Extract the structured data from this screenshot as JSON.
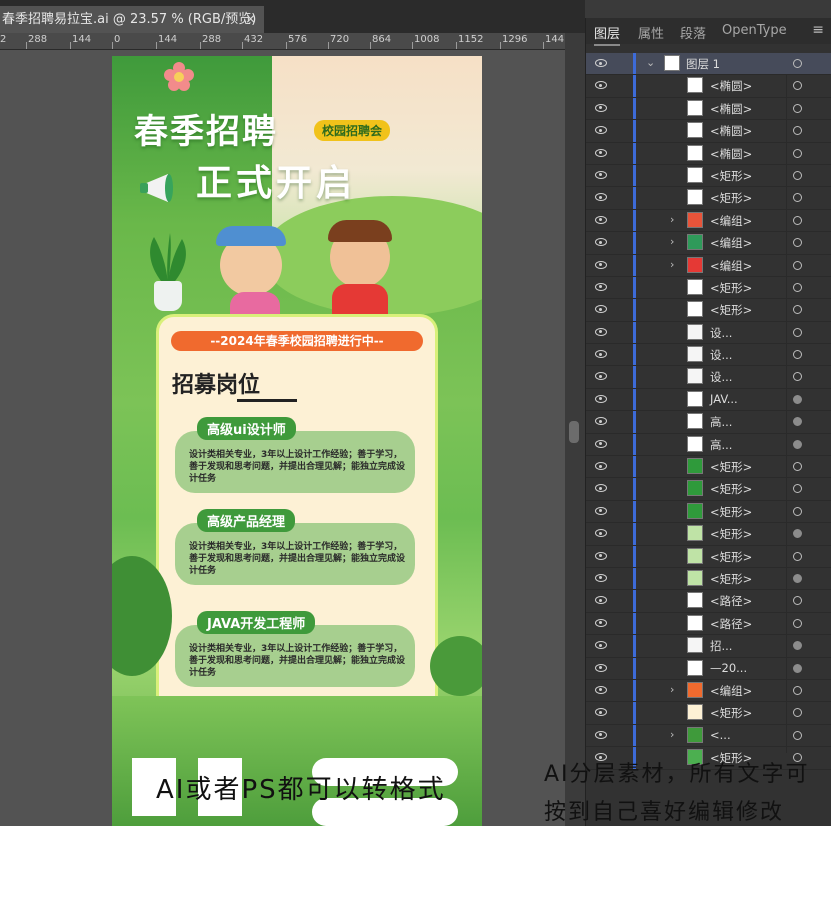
{
  "document": {
    "tab_title": "春季招聘易拉宝.ai @ 23.57 % (RGB/预览)",
    "close_glyph": "×"
  },
  "ruler": {
    "ticks": [
      "2",
      "288",
      "144",
      "0",
      "144",
      "288",
      "432",
      "576",
      "720",
      "864",
      "1008",
      "1152",
      "1296",
      "144"
    ]
  },
  "poster": {
    "title_line1": "春季招聘",
    "badge": "校园招聘会",
    "title_line2": "正式开启",
    "banner": "--2024年春季校园招聘进行中--",
    "section_title": "招募岗位",
    "jobs": [
      {
        "title": "高级ui设计师",
        "desc": "设计类相关专业，3年以上设计工作经验；善于学习，善于发现和思考问题，并提出合理见解；能独立完成设计任务"
      },
      {
        "title": "高级产品经理",
        "desc": "设计类相关专业，3年以上设计工作经验；善于学习，善于发现和思考问题，并提出合理见解；能独立完成设计任务"
      },
      {
        "title": "JAVA开发工程师",
        "desc": "设计类相关专业，3年以上设计工作经验；善于学习，善于发现和思考问题，并提出合理见解；能独立完成设计任务"
      }
    ]
  },
  "panel": {
    "tabs": [
      "图层",
      "属性",
      "段落",
      "OpenType"
    ],
    "menu_glyph": "≡",
    "layers": [
      {
        "name": "图层 1",
        "caret": "⌄",
        "selected": true,
        "circle": "open",
        "thumb": "top"
      },
      {
        "name": "<椭圆>",
        "caret": "",
        "circle": "open",
        "thumb": "white"
      },
      {
        "name": "<椭圆>",
        "caret": "",
        "circle": "open",
        "thumb": "white"
      },
      {
        "name": "<椭圆>",
        "caret": "",
        "circle": "open",
        "thumb": "white"
      },
      {
        "name": "<椭圆>",
        "caret": "",
        "circle": "open",
        "thumb": "white"
      },
      {
        "name": "<矩形>",
        "caret": "",
        "circle": "open",
        "thumb": "white"
      },
      {
        "name": "<矩形>",
        "caret": "",
        "circle": "open",
        "thumb": "white"
      },
      {
        "name": "<编组>",
        "caret": "›",
        "circle": "open",
        "thumb": "pin"
      },
      {
        "name": "<编组>",
        "caret": "›",
        "circle": "open",
        "thumb": "globe"
      },
      {
        "name": "<编组>",
        "caret": "›",
        "circle": "open",
        "thumb": "phone"
      },
      {
        "name": "<矩形>",
        "caret": "",
        "circle": "open",
        "thumb": "white"
      },
      {
        "name": "<矩形>",
        "caret": "",
        "circle": "open",
        "thumb": "white"
      },
      {
        "name": "设...",
        "caret": "",
        "circle": "open",
        "thumb": "text"
      },
      {
        "name": "设...",
        "caret": "",
        "circle": "open",
        "thumb": "text"
      },
      {
        "name": "设...",
        "caret": "",
        "circle": "open",
        "thumb": "text"
      },
      {
        "name": "JAV...",
        "caret": "",
        "circle": "filled",
        "thumb": "line"
      },
      {
        "name": "高...",
        "caret": "",
        "circle": "filled",
        "thumb": "line"
      },
      {
        "name": "高...",
        "caret": "",
        "circle": "filled",
        "thumb": "line"
      },
      {
        "name": "<矩形>",
        "caret": "",
        "circle": "open",
        "thumb": "green"
      },
      {
        "name": "<矩形>",
        "caret": "",
        "circle": "open",
        "thumb": "green"
      },
      {
        "name": "<矩形>",
        "caret": "",
        "circle": "open",
        "thumb": "green"
      },
      {
        "name": "<矩形>",
        "caret": "",
        "circle": "filled",
        "thumb": "lightgreen"
      },
      {
        "name": "<矩形>",
        "caret": "",
        "circle": "open",
        "thumb": "lightgreen"
      },
      {
        "name": "<矩形>",
        "caret": "",
        "circle": "filled",
        "thumb": "lightgreen"
      },
      {
        "name": "<路径>",
        "caret": "",
        "circle": "open",
        "thumb": "line"
      },
      {
        "name": "<路径>",
        "caret": "",
        "circle": "open",
        "thumb": "line"
      },
      {
        "name": "招...",
        "caret": "",
        "circle": "filled",
        "thumb": "text"
      },
      {
        "name": "—20...",
        "caret": "",
        "circle": "filled",
        "thumb": "white"
      },
      {
        "name": "<编组>",
        "caret": "›",
        "circle": "open",
        "thumb": "orange"
      },
      {
        "name": "<矩形>",
        "caret": "",
        "circle": "open",
        "thumb": "cream"
      },
      {
        "name": "<...",
        "caret": "›",
        "circle": "open",
        "thumb": "plant"
      },
      {
        "name": "<矩形>",
        "caret": "",
        "circle": "open",
        "thumb": "poster"
      }
    ]
  },
  "captions": {
    "left": "AI或者PS都可以转格式",
    "right": "AI分层素材，所有文字可按到自己喜好编辑修改"
  },
  "colors": {
    "accent_blue": "#3d6bd8",
    "poster_green": "#3f9a3b",
    "banner_orange": "#f06a2e",
    "badge_yellow": "#f1c21a"
  }
}
